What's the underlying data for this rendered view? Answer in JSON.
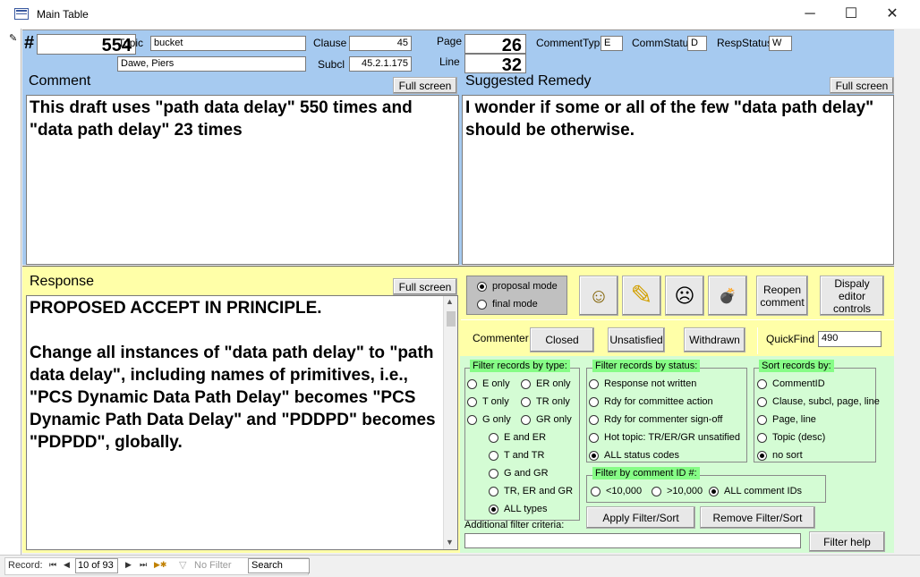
{
  "window": {
    "title": "Main Table",
    "minimize": "─",
    "maximize": "☐",
    "close": "✕"
  },
  "header": {
    "hash": "#",
    "comment_id": "554",
    "topic_label": "Topic",
    "topic": "bucket",
    "commenter": "Dawe, Piers",
    "clause_label": "Clause",
    "clause": "45",
    "subcl_label": "Subcl",
    "subcl": "45.2.1.175",
    "page_label": "Page",
    "page": "26",
    "line_label": "Line",
    "line": "32",
    "commenttype_label": "CommentType",
    "commenttype": "E",
    "commstatus_label": "CommStatus",
    "commstatus": "D",
    "respstatus_label": "RespStatus",
    "respstatus": "W"
  },
  "comment": {
    "label": "Comment",
    "fullscreen": "Full screen",
    "text": "This draft uses \"path data delay\" 550 times and \"data path delay\" 23 times"
  },
  "remedy": {
    "label": "Suggested Remedy",
    "fullscreen": "Full screen",
    "text": "I wonder if some or all of the few \"data path delay\" should be otherwise."
  },
  "response": {
    "label": "Response",
    "fullscreen": "Full screen",
    "text": "PROPOSED ACCEPT IN PRINCIPLE.\n\nChange all instances of \"data path delay\" to \"path data delay\", including names of primitives, i.e., \"PCS Dynamic Data Path Delay\" becomes \"PCS Dynamic Path Data Delay\" and \"PDDPD\" becomes \"PDPDD\", globally."
  },
  "mode": {
    "proposal": "proposal mode",
    "final": "final mode",
    "selected": "proposal"
  },
  "toolbar": {
    "smile": "☺",
    "pencil": "✎",
    "frown": "☹",
    "bomb": "💣",
    "reopen": "Reopen comment",
    "display_editor": "Dispaly editor controls"
  },
  "commenter_row": {
    "label": "Commenter",
    "closed": "Closed",
    "unsatisfied": "Unsatisfied",
    "withdrawn": "Withdrawn",
    "quickfind_label": "QuickFind",
    "quickfind_value": "490"
  },
  "filter_type": {
    "legend": "Filter records by type:",
    "options": [
      "E only",
      "ER only",
      "T only",
      "TR only",
      "G only",
      "GR only",
      "E and ER",
      "T and TR",
      "G and GR",
      "TR, ER and GR",
      "ALL types"
    ],
    "selected": "ALL types"
  },
  "filter_status": {
    "legend": "Filter records by status:",
    "options": [
      "Response not written",
      "Rdy for committee action",
      "Rdy for commenter sign-off",
      "Hot topic: TR/ER/GR unsatified",
      "ALL status codes"
    ],
    "selected": "ALL status codes"
  },
  "sort": {
    "legend": "Sort records by:",
    "options": [
      "CommentID",
      "Clause, subcl, page, line",
      "Page, line",
      "Topic (desc)",
      "no sort"
    ],
    "selected": "no sort"
  },
  "filter_id": {
    "legend": "Filter by comment ID #:",
    "options": [
      "<10,000",
      ">10,000",
      "ALL comment IDs"
    ],
    "selected": "ALL comment IDs"
  },
  "actions": {
    "apply": "Apply Filter/Sort",
    "remove": "Remove Filter/Sort",
    "additional_label": "Additional filter criteria:",
    "additional_value": "",
    "help": "Filter help"
  },
  "statusbar": {
    "record_label": "Record:",
    "first": "⏮",
    "prev": "◀",
    "record_value": "10 of 93",
    "next": "▶",
    "last": "⏭",
    "new": "▶✱",
    "nofilter": "No Filter",
    "search": "Search"
  }
}
